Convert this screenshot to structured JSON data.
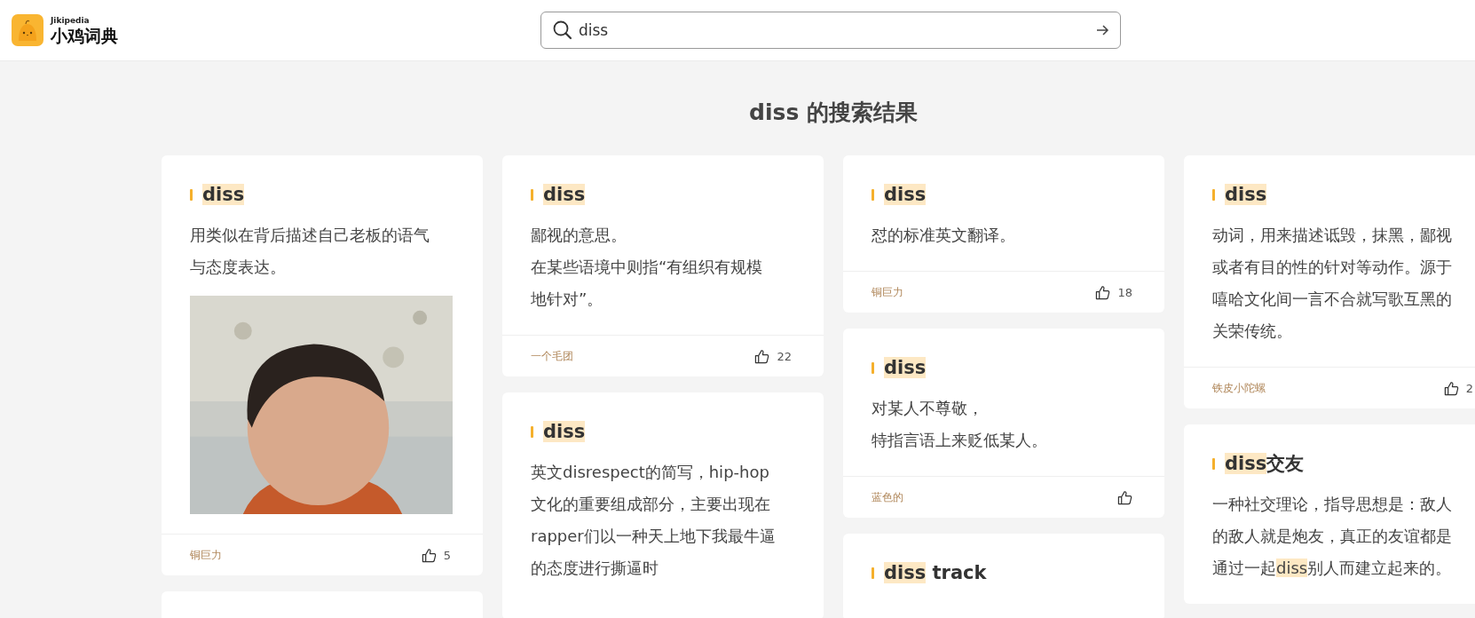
{
  "header": {
    "logo_sub": "Jikipedia",
    "logo_name": "小鸡词典",
    "search": {
      "value": "diss"
    }
  },
  "heading": "diss 的搜索结果",
  "columns": [
    [
      {
        "kind": "entry",
        "title": [
          {
            "text": "diss",
            "highlight": true
          }
        ],
        "description": [
          [
            {
              "text": "用类似在背后描述自己老板的语气与态度表达。",
              "highlight": false
            }
          ]
        ],
        "image": {
          "kind": "picture"
        },
        "author": "铜巨力",
        "likes": "5"
      },
      {
        "kind": "partial"
      }
    ],
    [
      {
        "kind": "entry",
        "title": [
          {
            "text": "diss",
            "highlight": true
          }
        ],
        "description": [
          [
            {
              "text": "鄙视的意思。",
              "highlight": false
            }
          ],
          [
            {
              "text": "在某些语境中则指“有组织有规模地针对”。",
              "highlight": false
            }
          ]
        ],
        "author": "一个毛团",
        "likes": "22"
      },
      {
        "kind": "open",
        "title": [
          {
            "text": "diss",
            "highlight": true
          }
        ],
        "description": [
          [
            {
              "text": "英文disrespect的简写，hip-hop文化的重要组成部分，主要出现在rapper们以一种天上地下我最牛逼的态度进行撕逼时",
              "highlight": false
            }
          ]
        ]
      }
    ],
    [
      {
        "kind": "entry",
        "title": [
          {
            "text": "diss",
            "highlight": true
          }
        ],
        "description": [
          [
            {
              "text": "怼的标准英文翻译。",
              "highlight": false
            }
          ]
        ],
        "author": "铜巨力",
        "likes": "18"
      },
      {
        "kind": "entry",
        "title": [
          {
            "text": "diss",
            "highlight": true
          }
        ],
        "description": [
          [
            {
              "text": "对某人不尊敬，",
              "highlight": false
            }
          ],
          [
            {
              "text": "特指言语上来贬低某人。",
              "highlight": false
            }
          ]
        ],
        "author": "蓝色的"
      },
      {
        "kind": "open",
        "title": [
          {
            "text": "diss",
            "highlight": true
          },
          {
            "text": " track",
            "highlight": false
          }
        ]
      }
    ],
    [
      {
        "kind": "entry",
        "title": [
          {
            "text": "diss",
            "highlight": true
          }
        ],
        "description": [
          [
            {
              "text": "动词，用来描述诋毁，抹黑，鄙视或者有目的性的针对等动作。源于嘻哈文化间一言不合就写歌互黑的关荣传统。",
              "highlight": false
            }
          ]
        ],
        "author": "铁皮小陀螺",
        "likes": "2"
      },
      {
        "kind": "entry",
        "title": [
          {
            "text": "diss",
            "highlight": true
          },
          {
            "text": "交友",
            "highlight": false
          }
        ],
        "description": [
          [
            {
              "text": "一种社交理论，指导思想是：敌人的敌人就是炮友，真正的友谊都是通过一起",
              "highlight": false
            },
            {
              "text": "diss",
              "highlight": true
            },
            {
              "text": "别人而建立起来的。",
              "highlight": false
            }
          ]
        ]
      }
    ]
  ]
}
